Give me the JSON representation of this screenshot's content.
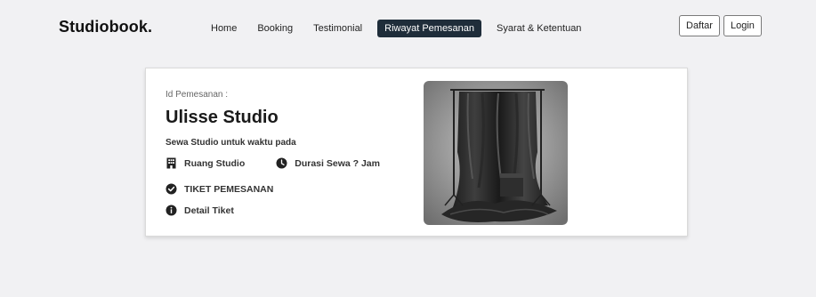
{
  "brand": "Studiobook.",
  "nav": {
    "links": [
      {
        "label": "Home",
        "active": false
      },
      {
        "label": "Booking",
        "active": false
      },
      {
        "label": "Testimonial",
        "active": false
      },
      {
        "label": "Riwayat Pemesanan",
        "active": true
      },
      {
        "label": "Syarat & Ketentuan",
        "active": false
      }
    ],
    "register_label": "Daftar",
    "login_label": "Login"
  },
  "booking_card": {
    "id_label": "Id Pemesanan :",
    "studio_name": "Ulisse Studio",
    "rent_text": "Sewa Studio untuk waktu pada",
    "room_label": "Ruang Studio",
    "duration_label": "Durasi Sewa ? Jam",
    "ticket_label": "TIKET PEMESANAN",
    "detail_label": "Detail Tiket",
    "icons": {
      "room": "building-icon",
      "duration": "clock-icon",
      "ticket": "check-circle-icon",
      "detail": "info-circle-icon"
    }
  },
  "colors": {
    "active_nav_bg": "#1f2d3a",
    "page_bg": "#f1f1f3",
    "card_bg": "#ffffff"
  }
}
